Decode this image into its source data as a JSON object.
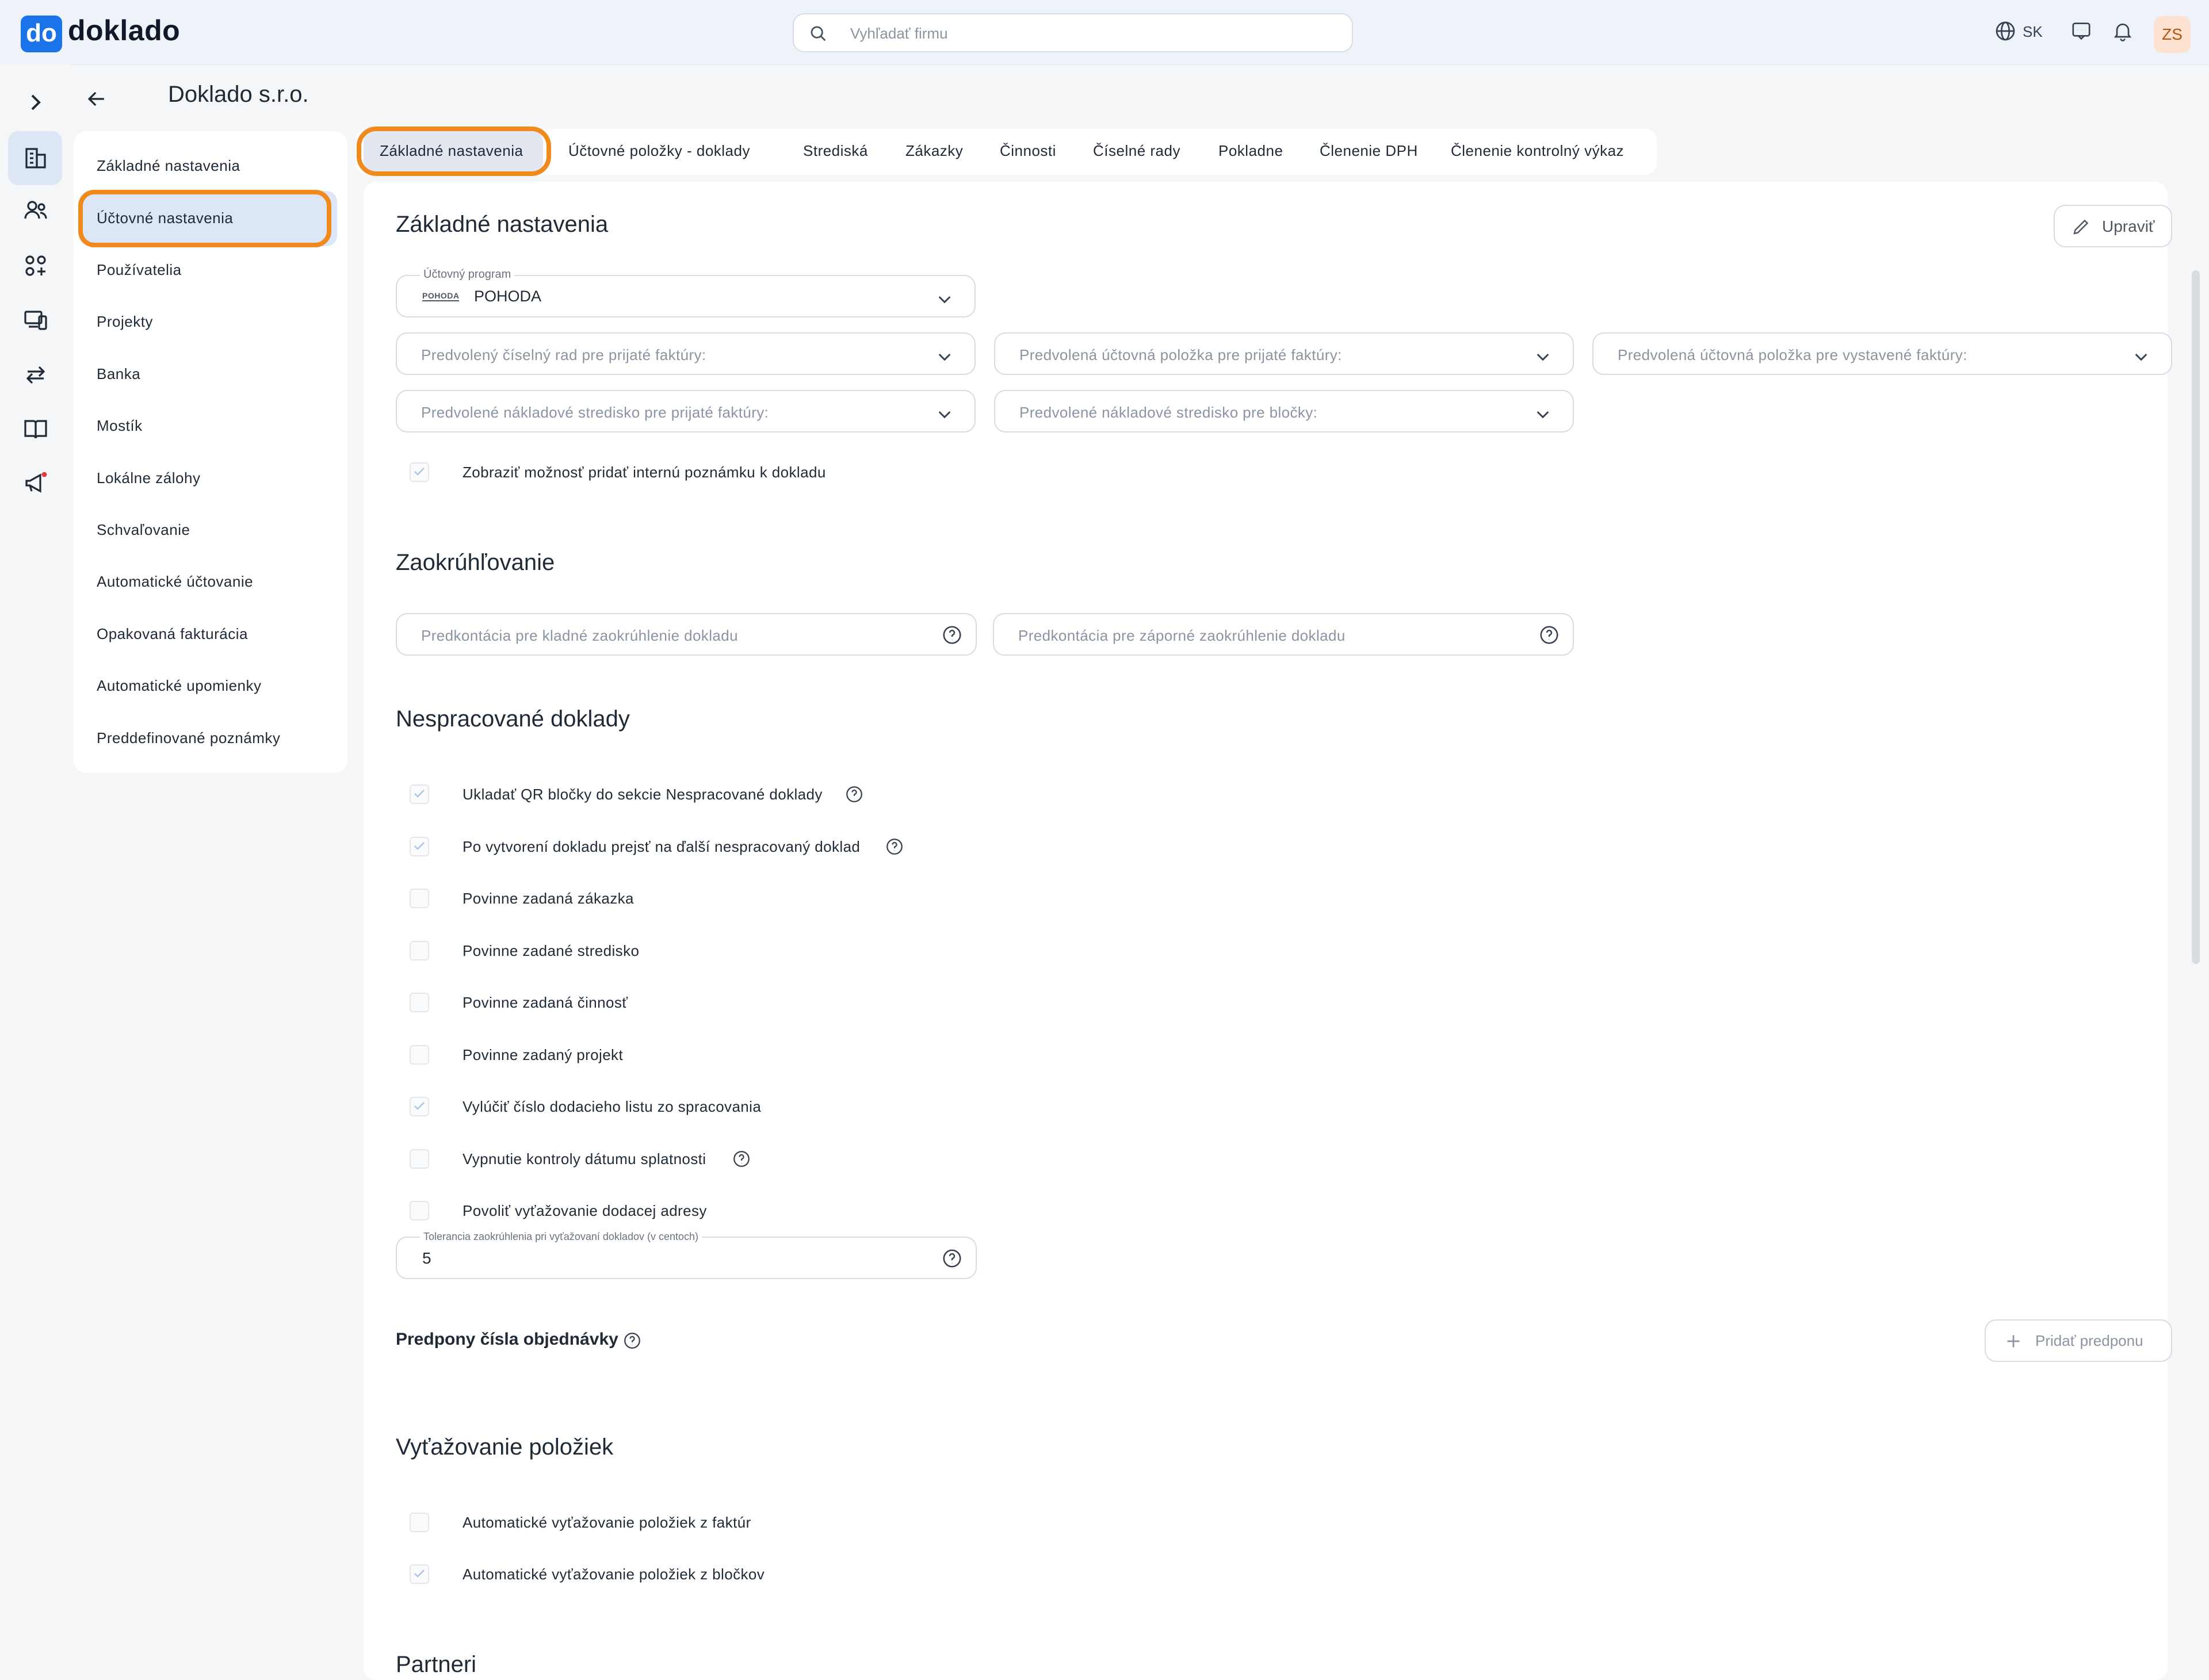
{
  "app": {
    "logo_mark": "do",
    "logo_text": "doklado"
  },
  "search": {
    "placeholder": "Vyhľadať firmu"
  },
  "header": {
    "language": "SK",
    "avatar_initials": "ZS"
  },
  "page": {
    "title": "Doklado s.r.o."
  },
  "rail": {
    "icons": [
      "expand-icon",
      "building-icon",
      "users-icon",
      "apps-icon",
      "devices-icon",
      "transfer-icon",
      "book-icon",
      "megaphone-icon"
    ]
  },
  "subnav": {
    "items": [
      "Základné nastavenia",
      "Účtovné nastavenia",
      "Používatelia",
      "Projekty",
      "Banka",
      "Mostík",
      "Lokálne zálohy",
      "Schvaľovanie",
      "Automatické účtovanie",
      "Opakovaná fakturácia",
      "Automatické upomienky",
      "Preddefinované poznámky"
    ],
    "active_index": 1
  },
  "tabs": {
    "items": [
      "Základné nastavenia",
      "Účtovné položky - doklady",
      "Strediská",
      "Zákazky",
      "Činnosti",
      "Číselné rady",
      "Pokladne",
      "Členenie DPH",
      "Členenie kontrolný výkaz"
    ],
    "active_index": 0
  },
  "basic": {
    "title": "Základné nastavenia",
    "edit_label": "Upraviť",
    "program_label": "Účtovný program",
    "program_logo": "POHODA",
    "program_value": "POHODA",
    "default_series_received": "Predvolený číselný rad pre prijaté faktúry:",
    "default_item_received": "Predvolená účtovná položka pre prijaté faktúry:",
    "default_item_issued": "Predvolená účtovná položka pre vystavené faktúry:",
    "default_center_received": "Predvolené nákladové stredisko pre prijaté faktúry:",
    "default_center_receipts": "Predvolené nákladové stredisko pre bločky:",
    "internal_note": "Zobraziť možnosť pridať internú poznámku k dokladu"
  },
  "rounding": {
    "title": "Zaokrúhľovanie",
    "positive": "Predkontácia pre kladné zaokrúhlenie dokladu",
    "negative": "Predkontácia pre záporné zaokrúhlenie dokladu"
  },
  "unprocessed": {
    "title": "Nespracované doklady",
    "items": [
      {
        "label": "Ukladať QR bločky do sekcie Nespracované doklady",
        "checked": true,
        "help": true
      },
      {
        "label": "Po vytvorení dokladu prejsť na ďalší nespracovaný doklad",
        "checked": true,
        "help": true
      },
      {
        "label": "Povinne zadaná zákazka",
        "checked": false,
        "help": false
      },
      {
        "label": "Povinne zadané stredisko",
        "checked": false,
        "help": false
      },
      {
        "label": "Povinne zadaná činnosť",
        "checked": false,
        "help": false
      },
      {
        "label": "Povinne zadaný projekt",
        "checked": false,
        "help": false
      },
      {
        "label": "Vylúčiť číslo dodacieho listu zo spracovania",
        "checked": true,
        "help": false
      },
      {
        "label": "Vypnutie kontroly dátumu splatnosti",
        "checked": false,
        "help": true
      },
      {
        "label": "Povoliť vyťažovanie dodacej adresy",
        "checked": false,
        "help": false
      }
    ],
    "tolerance_label": "Tolerancia zaokrúhlenia pri vyťažovaní dokladov (v centoch)",
    "tolerance_value": "5"
  },
  "prefixes": {
    "title": "Predpony čísla objednávky",
    "add_label": "Pridať predponu"
  },
  "extraction": {
    "title": "Vyťažovanie položiek",
    "items": [
      {
        "label": "Automatické vyťažovanie položiek z faktúr",
        "checked": false
      },
      {
        "label": "Automatické vyťažovanie položiek z bločkov",
        "checked": true
      }
    ]
  },
  "partners": {
    "title": "Partneri"
  },
  "colors": {
    "accent": "#1a73e8",
    "highlight": "#f08a1c",
    "active_bg": "#dce6f7"
  }
}
